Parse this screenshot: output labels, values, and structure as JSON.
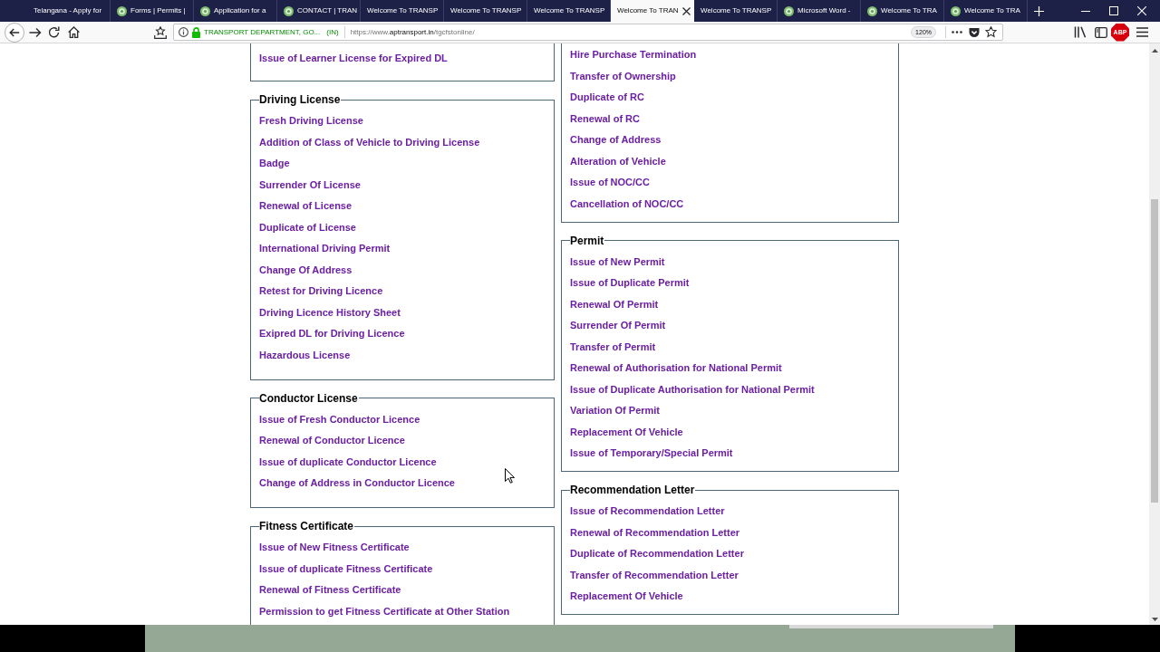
{
  "tabs": [
    {
      "title": "Telangana - Apply for",
      "favicon": false,
      "selected": false
    },
    {
      "title": "Forms | Permits |",
      "favicon": true,
      "selected": false
    },
    {
      "title": "Application for a",
      "favicon": true,
      "selected": false
    },
    {
      "title": "CONTACT | TRAN",
      "favicon": true,
      "selected": false
    },
    {
      "title": "Welcome To TRANSP",
      "favicon": false,
      "selected": false
    },
    {
      "title": "Welcome To TRANSP",
      "favicon": false,
      "selected": false
    },
    {
      "title": "Welcome To TRANSP",
      "favicon": false,
      "selected": false
    },
    {
      "title": "Welcome To TRAN",
      "favicon": false,
      "selected": true
    },
    {
      "title": "Welcome To TRANSP",
      "favicon": false,
      "selected": false
    },
    {
      "title": "Microsoft Word -",
      "favicon": true,
      "selected": false
    },
    {
      "title": "Welcome To TRA",
      "favicon": true,
      "selected": false
    },
    {
      "title": "Welcome To TRA",
      "favicon": true,
      "selected": false
    }
  ],
  "toolbar": {
    "identity": "TRANSPORT DEPARTMENT, GO...",
    "country": "(IN)",
    "url": {
      "scheme": "https://www.",
      "domain": "aptransport.in",
      "path": "/tgcfstonline/"
    },
    "zoom": "120%",
    "adblock": "ABP"
  },
  "page": {
    "left_column": [
      {
        "items": [
          "Issue of Learner License for Expired DL"
        ]
      },
      {
        "legend": "Driving License",
        "items": [
          "Fresh Driving License",
          "Addition of Class of Vehicle to Driving License",
          "Badge",
          "Surrender Of License",
          "Renewal of License",
          "Duplicate of License",
          "International Driving Permit",
          "Change Of Address",
          "Retest for Driving Licence",
          "Driving Licence History Sheet",
          "Exipred DL for Driving Licence",
          "Hazardous License"
        ]
      },
      {
        "legend": "Conductor License",
        "items": [
          "Issue of Fresh Conductor Licence",
          "Renewal of Conductor Licence",
          "Issue of duplicate Conductor Licence",
          "Change of Address in Conductor Licence"
        ]
      },
      {
        "legend": "Fitness Certificate",
        "items": [
          "Issue of New Fitness Certificate",
          "Issue of duplicate Fitness Certificate",
          "Renewal of Fitness Certificate",
          "Permission to get Fitness Certificate at Other Station"
        ]
      }
    ],
    "right_column": [
      {
        "items": [
          "Hire Purchase Termination",
          "Transfer of Ownership",
          "Duplicate of RC",
          "Renewal of RC",
          "Change of Address",
          "Alteration of Vehicle",
          "Issue of NOC/CC",
          "Cancellation of NOC/CC"
        ]
      },
      {
        "legend": "Permit",
        "items": [
          "Issue of New Permit",
          "Issue of Duplicate Permit",
          "Renewal Of Permit",
          "Surrender Of Permit",
          "Transfer of Permit",
          "Renewal of Authorisation for National Permit",
          "Issue of Duplicate Authorisation for National Permit",
          "Variation Of Permit",
          "Replacement Of Vehicle",
          "Issue of Temporary/Special Permit"
        ]
      },
      {
        "legend": "Recommendation Letter",
        "items": [
          "Issue of Recommendation Letter",
          "Renewal of Recommendation Letter",
          "Duplicate of Recommendation Letter",
          "Transfer of Recommendation Letter",
          "Replacement Of Vehicle"
        ]
      }
    ]
  }
}
